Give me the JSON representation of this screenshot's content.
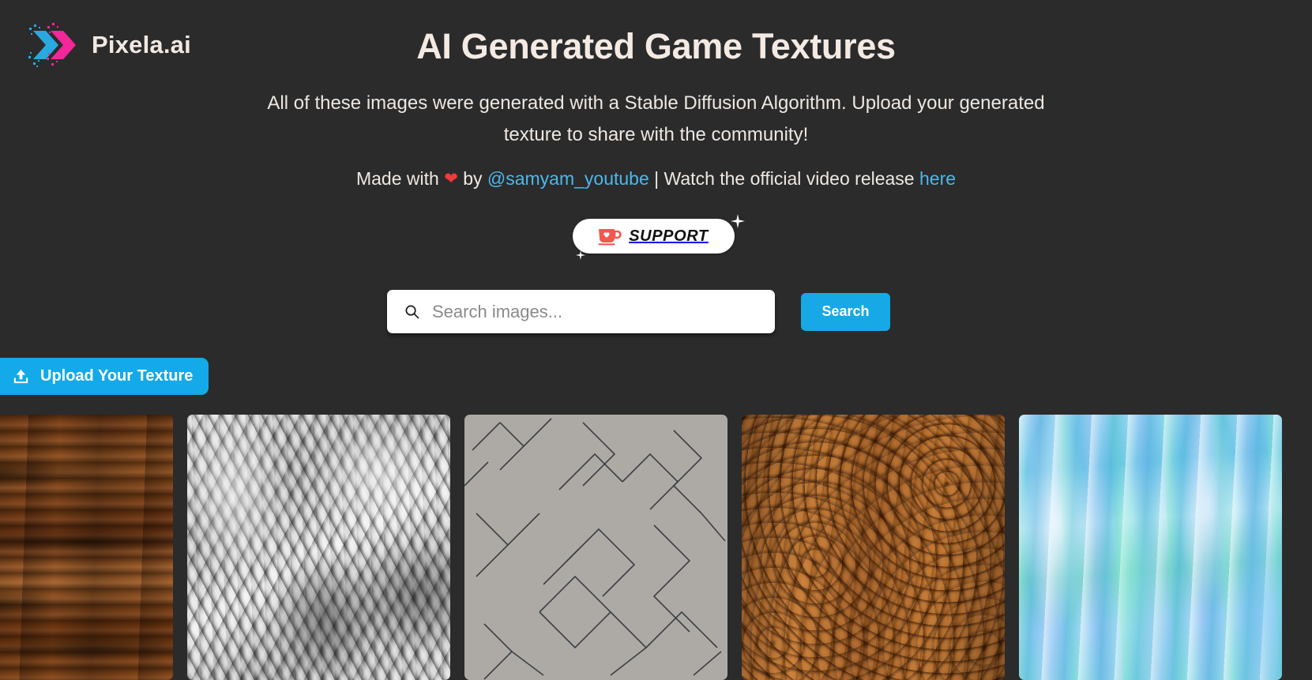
{
  "brand": {
    "name": "Pixela.ai",
    "logo_icon": "double-chevron-pixel-logo"
  },
  "header": {
    "title": "AI Generated Game Textures",
    "subtitle": "All of these images were generated with a Stable Diffusion Algorithm. Upload your generated texture to share with the community!",
    "credit": {
      "prefix": "Made with",
      "heart": "❤",
      "by": "by",
      "author": "@samyam_youtube",
      "separator": "|",
      "middle": "Watch the official video release",
      "link": "here"
    }
  },
  "support": {
    "label": "SUPPORT",
    "icon": "coffee-cup-heart-icon",
    "sparkle_icon": "sparkle-icon"
  },
  "search": {
    "placeholder": "Search images...",
    "value": "",
    "icon": "search-icon",
    "button_label": "Search"
  },
  "upload": {
    "label": "Upload Your Texture",
    "icon": "upload-icon"
  },
  "gallery": {
    "items": [
      {
        "texture": "dark-wood-plank",
        "style_class": "tex-wood-dark"
      },
      {
        "texture": "grayscale-fur",
        "style_class": "tex-fur"
      },
      {
        "texture": "gray-herringbone-tile",
        "style_class": "tex-tile"
      },
      {
        "texture": "orange-wood-rings",
        "style_class": "tex-wood-rings"
      },
      {
        "texture": "blue-watercolor-streaks",
        "style_class": "tex-water"
      }
    ]
  },
  "colors": {
    "background": "#2b2b2b",
    "accent_blue": "#17a9e5",
    "link_blue": "#4cb8ec",
    "heading_cream": "#f4eae4",
    "heart_red": "#ef3b3b",
    "logo_cyan": "#29a9e0",
    "logo_pink": "#f3269a",
    "support_white": "#ffffff",
    "support_cup_red": "#f5564e"
  }
}
